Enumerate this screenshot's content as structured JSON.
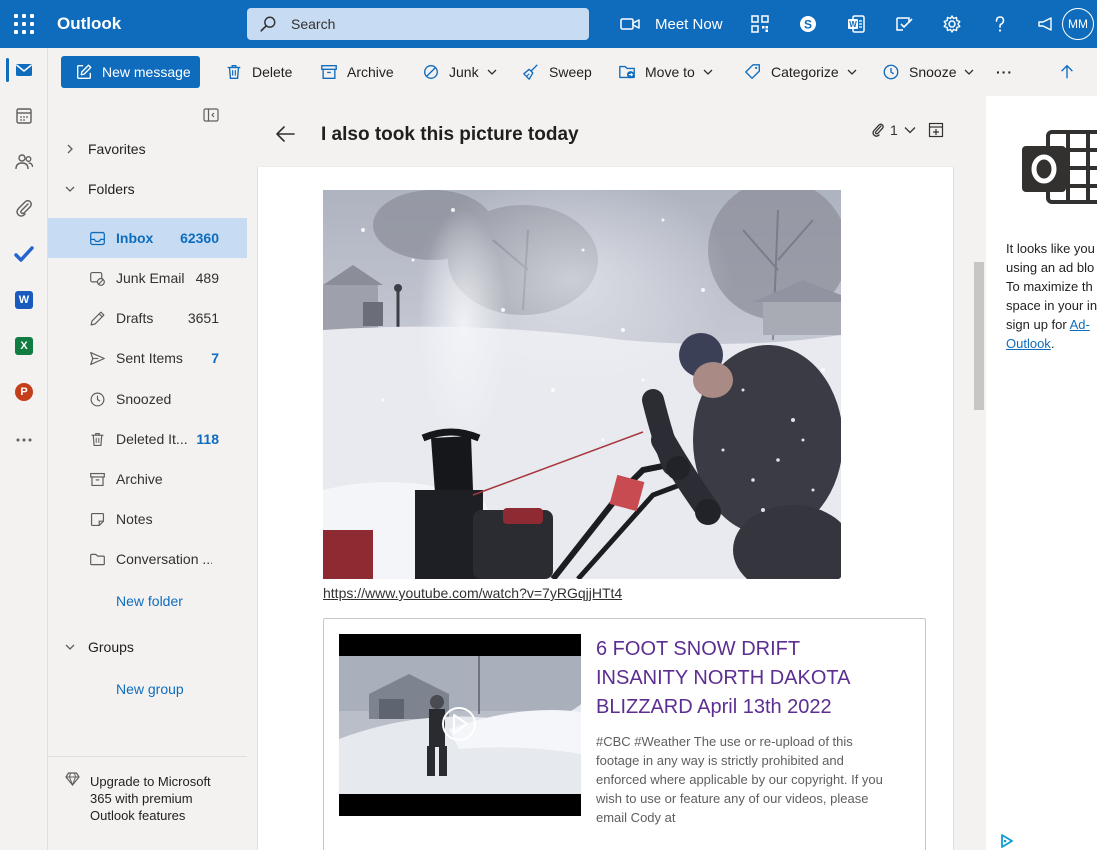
{
  "app": {
    "title": "Outlook",
    "avatar_initials": "MM"
  },
  "search": {
    "placeholder": "Search"
  },
  "header": {
    "meet_now": "Meet Now",
    "icons": [
      "waffle-icon",
      "video-icon",
      "qr-icon",
      "skype-icon",
      "office-word-icon",
      "feedback-icon",
      "gear-icon",
      "help-icon",
      "megaphone-icon"
    ]
  },
  "toolbar": {
    "new_message": "New message",
    "delete": "Delete",
    "archive": "Archive",
    "junk": "Junk",
    "sweep": "Sweep",
    "move_to": "Move to",
    "categorize": "Categorize",
    "snooze": "Snooze",
    "more": "···"
  },
  "nav": {
    "favorites": "Favorites",
    "folders_label": "Folders",
    "folders": [
      {
        "name": "Inbox",
        "count": "62360"
      },
      {
        "name": "Junk Email",
        "count": "489"
      },
      {
        "name": "Drafts",
        "count": "3651"
      },
      {
        "name": "Sent Items",
        "count": "7"
      },
      {
        "name": "Snoozed",
        "count": ""
      },
      {
        "name": "Deleted It...",
        "count": "118"
      },
      {
        "name": "Archive",
        "count": ""
      },
      {
        "name": "Notes",
        "count": ""
      },
      {
        "name": "Conversation ...",
        "count": ""
      }
    ],
    "new_folder": "New folder",
    "groups_label": "Groups",
    "new_group": "New group",
    "upgrade": "Upgrade to Microsoft 365 with premium Outlook features"
  },
  "message": {
    "subject": "I also took this picture today",
    "attachment_count": "1",
    "link": "https://www.youtube.com/watch?v=7yRGqjjHTt4",
    "preview": {
      "title": "6 FOOT SNOW DRIFT INSANITY NORTH DAKOTA BLIZZARD April 13th 2022",
      "description": "#CBC #Weather The use or re-upload of this footage in any way is strictly prohibited and enforced where applicable by our copyright. If you wish to use or feature any of our videos, please email Cody at"
    }
  },
  "ad": {
    "lines": [
      "It looks like you",
      "using an ad blo",
      "To maximize th",
      "space in your in",
      "sign up for "
    ],
    "link_text": "Ad-",
    "link_text_2": "Outlook",
    "suffix": "."
  },
  "colors": {
    "brand": "#0f6cbd",
    "selected": "#c7dcf3",
    "visited_link": "#5c2e91"
  }
}
